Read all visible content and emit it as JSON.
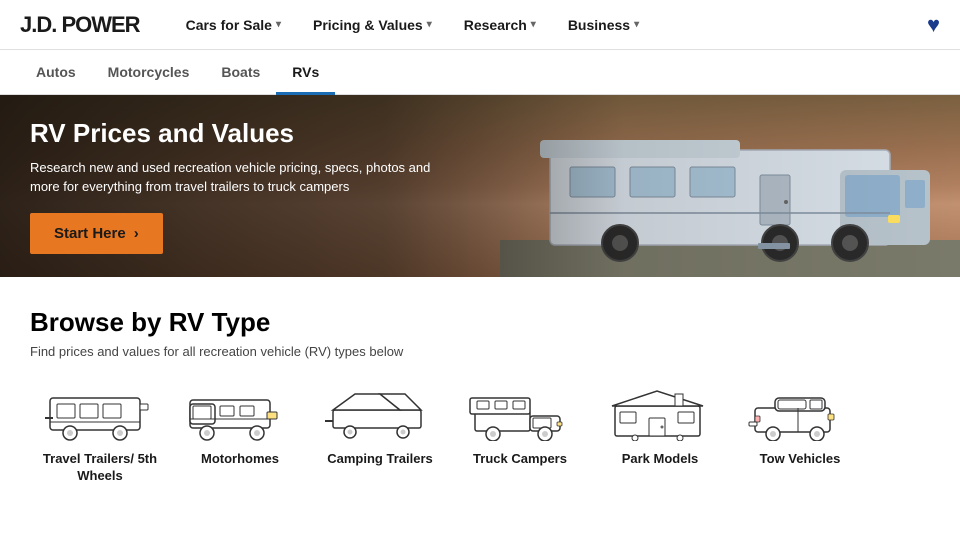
{
  "header": {
    "logo": "J.D. POWER",
    "nav": [
      {
        "label": "Cars for Sale",
        "hasArrow": true
      },
      {
        "label": "Pricing & Values",
        "hasArrow": true
      },
      {
        "label": "Research",
        "hasArrow": true
      },
      {
        "label": "Business",
        "hasArrow": true
      }
    ]
  },
  "subNav": {
    "items": [
      {
        "label": "Autos",
        "active": false
      },
      {
        "label": "Motorcycles",
        "active": false
      },
      {
        "label": "Boats",
        "active": false
      },
      {
        "label": "RVs",
        "active": true
      }
    ]
  },
  "hero": {
    "title": "RV Prices and Values",
    "subtitle": "Research new and used recreation vehicle pricing, specs, photos and more for everything from travel trailers to truck campers",
    "btnLabel": "Start Here",
    "btnArrow": "›"
  },
  "browse": {
    "title": "Browse by RV Type",
    "subtitle": "Find prices and values for all recreation vehicle (RV) types below",
    "types": [
      {
        "label": "Travel Trailers/ 5th Wheels",
        "icon": "travel-trailer"
      },
      {
        "label": "Motorhomes",
        "icon": "motorhome"
      },
      {
        "label": "Camping Trailers",
        "icon": "camping-trailer"
      },
      {
        "label": "Truck Campers",
        "icon": "truck-camper"
      },
      {
        "label": "Park Models",
        "icon": "park-model"
      },
      {
        "label": "Tow Vehicles",
        "icon": "tow-vehicle"
      }
    ]
  }
}
